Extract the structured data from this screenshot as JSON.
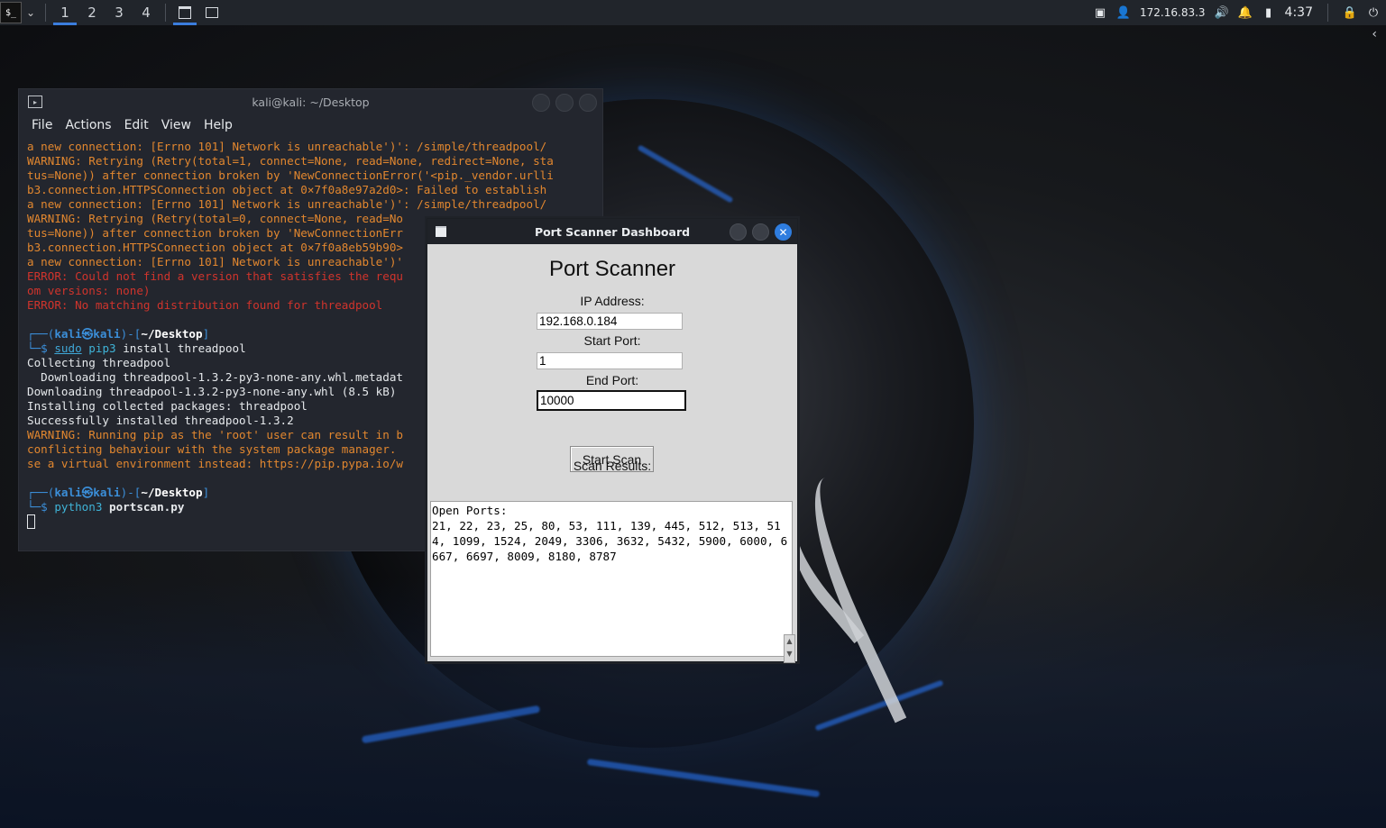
{
  "panel": {
    "workspaces": [
      "1",
      "2",
      "3",
      "4"
    ],
    "ip": "172.16.83.3",
    "time": "4:37"
  },
  "terminal": {
    "title": "kali@kali: ~/Desktop",
    "menu": [
      "File",
      "Actions",
      "Edit",
      "View",
      "Help"
    ],
    "lines": {
      "l1": "a new connection: [Errno 101] Network is unreachable')': /simple/threadpool/",
      "l2": "WARNING: Retrying (Retry(total=1, connect=None, read=None, redirect=None, sta",
      "l3": "tus=None)) after connection broken by 'NewConnectionError('<pip._vendor.urlli",
      "l4": "b3.connection.HTTPSConnection object at 0×7f0a8e97a2d0>: Failed to establish",
      "l5": "a new connection: [Errno 101] Network is unreachable')': /simple/threadpool/",
      "l6": "WARNING: Retrying (Retry(total=0, connect=None, read=No",
      "l7": "tus=None)) after connection broken by 'NewConnectionErr",
      "l8": "b3.connection.HTTPSConnection object at 0×7f0a8eb59b90>",
      "l9": "a new connection: [Errno 101] Network is unreachable')'",
      "l10": "ERROR: Could not find a version that satisfies the requ",
      "l11": "om versions: none)",
      "l12": "ERROR: No matching distribution found for threadpool",
      "p1_user": "kali㉿kali",
      "p1_dir": "~/Desktop",
      "cmd1_sudo": "sudo",
      "cmd1_pip": "pip3",
      "cmd1_rest": " install threadpool",
      "l13": "Collecting threadpool",
      "l14": "  Downloading threadpool-1.3.2-py3-none-any.whl.metadat",
      "l15": "Downloading threadpool-1.3.2-py3-none-any.whl (8.5 kB)",
      "l16": "Installing collected packages: threadpool",
      "l17": "Successfully installed threadpool-1.3.2",
      "l18": "WARNING: Running pip as the 'root' user can result in b",
      "l19": "conflicting behaviour with the system package manager.",
      "l20": "se a virtual environment instead: https://pip.pypa.io/w",
      "p2_user": "kali㉿kali",
      "p2_dir": "~/Desktop",
      "cmd2_py": "python3",
      "cmd2_file": "portscan.py"
    }
  },
  "dialog": {
    "title": "Port Scanner Dashboard",
    "heading": "Port Scanner",
    "ip_label": "IP Address:",
    "ip_value": "192.168.0.184",
    "start_label": "Start Port:",
    "start_value": "1",
    "end_label": "End Port:",
    "end_value": "10000",
    "scan_button": "Start Scan",
    "results_label": "Scan Results:",
    "results_text": "Open Ports:\n21, 22, 23, 25, 80, 53, 111, 139, 445, 512, 513, 514, 1099, 1524, 2049, 3306, 3632, 5432, 5900, 6000, 6667, 6697, 8009, 8180, 8787"
  }
}
